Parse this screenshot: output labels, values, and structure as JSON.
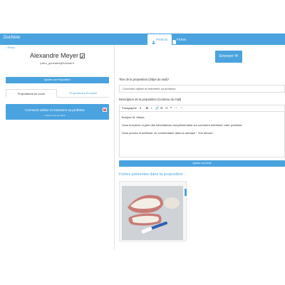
{
  "app": {
    "brand": "DocNote"
  },
  "tabs": [
    {
      "label": "Patients"
    },
    {
      "label": "Fiches"
    }
  ],
  "left": {
    "back_label": "< Retour",
    "patient_name": "Alexandre Meyer",
    "patient_email": "julien_gonzalez@hotmail.fr",
    "add_button": "Ajouter une Proposition",
    "tabs": [
      "Propositions en cours",
      "Propositions Envoyée"
    ],
    "proposition": {
      "title": "Comment utiliser et entretenir sa prothèse",
      "date": "Créée le 06 mai 2019"
    }
  },
  "right": {
    "send_button": "Envoyer ✉",
    "title_label": "Titre de la proposition (Objet du mail)*",
    "title_value": "Comment utiliser et entretenir sa prothèse",
    "desc_label": "Description de la proposition (Contenu du mail)",
    "toolbar": {
      "style": "Paragraphe",
      "bold": "B",
      "italic": "I",
      "link": "🔗",
      "bullets": "☰",
      "numbers": "☷",
      "quote": "❝",
      "undo": "↶",
      "redo": "↷"
    },
    "body": {
      "greeting": "Bonjour M. Meyer,",
      "line1": "Vous trouverez ci-joint des informations complémentaire sur comment entretenir votre prothèse.",
      "line2": "Vous pouvez m'adresser un commentaire dans la rubrique \" Vos retours\"."
    },
    "add_fiche_button": "Ajouter une fiche",
    "fiches_title": "Fiches présentes dans la proposition :"
  }
}
